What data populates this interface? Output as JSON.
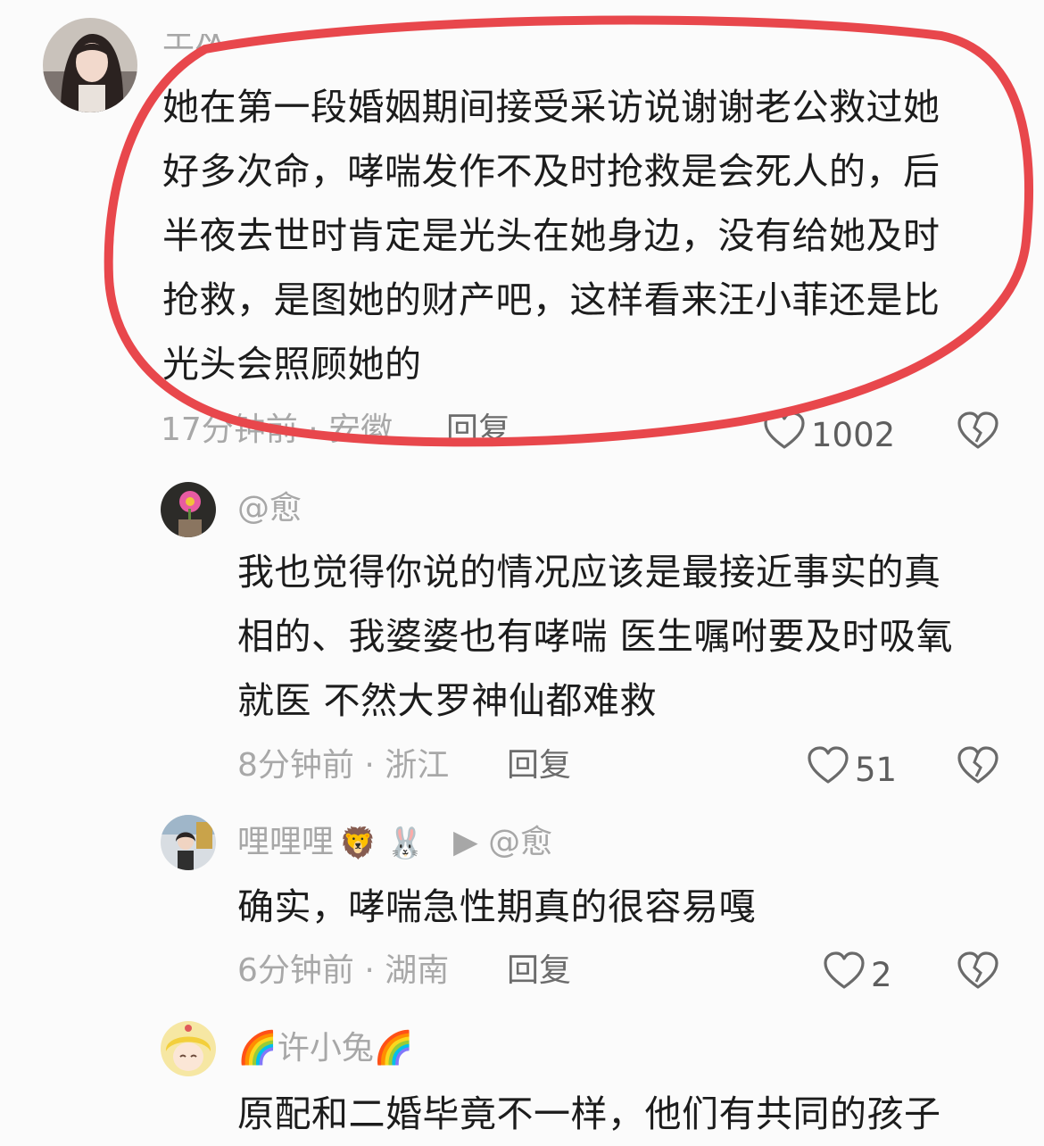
{
  "comments": [
    {
      "username": "王从",
      "text": "她在第一段婚姻期间接受采访说谢谢老公救过她\n好多次命，哮喘发作不及时抢救是会死人的，后\n半夜去世时肯定是光头在她身边，没有给她及时\n抢救，是图她的财产吧，这样看来汪小菲还是比\n光头会照顾她的",
      "meta": "17分钟前 · 安徽",
      "reply_label": "回复",
      "likes": "1002"
    },
    {
      "username": "@愈",
      "text": "我也觉得你说的情况应该是最接近事实的真\n相的、我婆婆也有哮喘 医生嘱咐要及时吸氧\n就医 不然大罗神仙都难救",
      "meta": "8分钟前 · 浙江",
      "reply_label": "回复",
      "likes": "51"
    },
    {
      "username": "哩哩哩",
      "username_emojis": "🦁 🐰",
      "reply_to": "▶ @愈",
      "text": "确实，哮喘急性期真的很容易嘎",
      "meta": "6分钟前 · 湖南",
      "reply_label": "回复",
      "likes": "2"
    },
    {
      "username": "许小兔",
      "username_prefix_emoji": "🌈",
      "username_suffix_emoji": "🌈",
      "text": "原配和二婚毕竟不一样，他们有共同的孩子"
    }
  ],
  "icons": {
    "like": "heart-outline-icon",
    "dislike": "broken-heart-icon"
  },
  "colors": {
    "highlight": "#e8474c",
    "secondary_text": "#a8a8a8",
    "body_text": "#1c1c1c"
  }
}
